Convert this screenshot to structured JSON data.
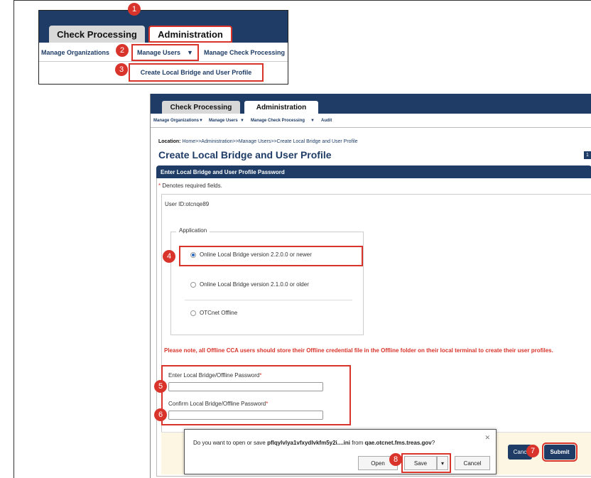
{
  "inset": {
    "tabs": [
      "Check Processing",
      "Administration"
    ],
    "menu": [
      "Manage Organizations",
      "Manage Users",
      "Manage Check Processing"
    ],
    "submenu_item": "Create Local Bridge and User Profile"
  },
  "badges": [
    "1",
    "2",
    "3",
    "4",
    "5",
    "6",
    "7",
    "8"
  ],
  "main": {
    "tabs": [
      "Check Processing",
      "Administration"
    ],
    "menu": [
      "Manage Organizations",
      "Manage Users",
      "Manage Check Processing",
      "Audit"
    ],
    "location_label": "Location:",
    "location_path": "Home>>Administration>>Manage Users>>Create Local Bridge and User Profile",
    "page_title": "Create Local Bridge and User Profile",
    "page_num": "1",
    "section_header": "Enter Local Bridge and User Profile Password",
    "required_note": "Denotes required fields.",
    "user_id": "User ID:otcnqe89",
    "application_legend": "Application",
    "radios": [
      "Online Local Bridge version 2.2.0.0 or newer",
      "Online Local Bridge version 2.1.0.0 or older",
      "OTCnet Offline"
    ],
    "warning": "Please note, all Offline CCA users should store their Offline credential file in the Offline folder on their local terminal to create their user profiles.",
    "pw_label": "Enter Local Bridge/Offline Password",
    "confirm_label": "Confirm Local Bridge/Offline Password",
    "cancel": "Canc",
    "submit": "Submit"
  },
  "dialog": {
    "prefix": "Do you want to open or save ",
    "filename": "pflqylvlya1vfxydlvkfm5y2i....ini",
    "middle": " from ",
    "host": "qae.otcnet.fms.treas.gov",
    "suffix": "?",
    "open": "Open",
    "save": "Save",
    "cancel": "Cancel"
  }
}
